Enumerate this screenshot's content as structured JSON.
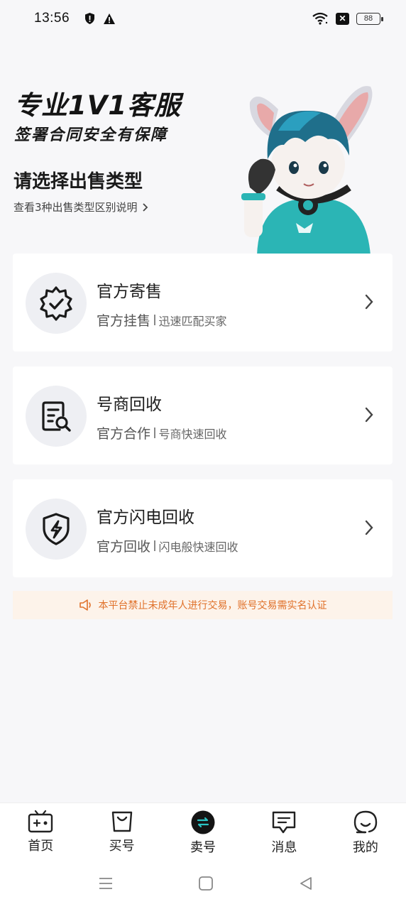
{
  "status_bar": {
    "time": "13:56",
    "battery": "88",
    "icons": [
      "shield-alert-icon",
      "warning-icon",
      "wifi-icon",
      "sim-x-icon",
      "battery-icon"
    ]
  },
  "hero": {
    "title": "专业1V1客服",
    "subtitle": "签署合同安全有保障",
    "heading": "请选择出售类型",
    "link": "查看3种出售类型区别说明"
  },
  "options": [
    {
      "title": "官方寄售",
      "desc_main": "官方挂售",
      "desc_sub": "迅速匹配买家",
      "icon": "verified-badge-icon"
    },
    {
      "title": "号商回收",
      "desc_main": "官方合作",
      "desc_sub": "号商快速回收",
      "icon": "document-search-icon"
    },
    {
      "title": "官方闪电回收",
      "desc_main": "官方回收",
      "desc_sub": "闪电般快速回收",
      "icon": "lightning-shield-icon"
    }
  ],
  "notice": {
    "text": "本平台禁止未成年人进行交易，账号交易需实名认证",
    "color": "#e0712a"
  },
  "bottom_nav": [
    {
      "label": "首页",
      "icon": "home-tv-icon"
    },
    {
      "label": "买号",
      "icon": "shopping-bag-icon"
    },
    {
      "label": "卖号",
      "icon": "swap-icon",
      "active": true
    },
    {
      "label": "消息",
      "icon": "message-icon"
    },
    {
      "label": "我的",
      "icon": "profile-icon"
    }
  ],
  "system_nav": [
    "menu-icon",
    "home-square-icon",
    "back-triangle-icon"
  ]
}
